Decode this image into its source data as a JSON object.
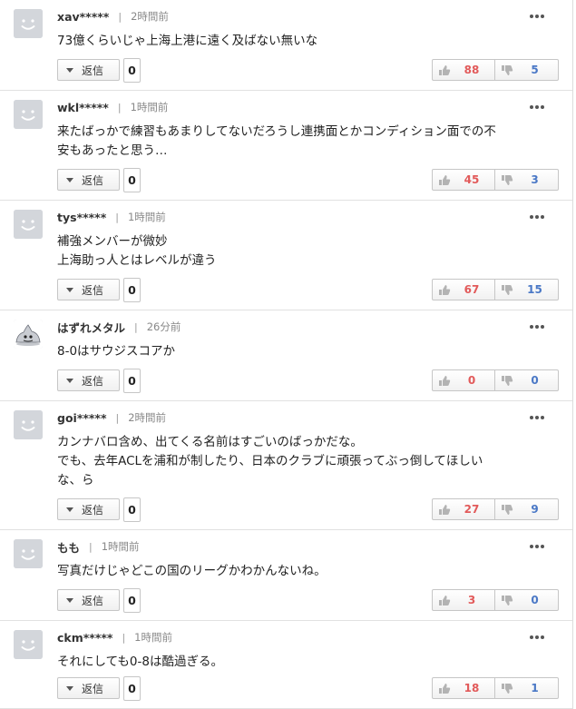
{
  "labels": {
    "reply": "返信"
  },
  "comments": [
    {
      "username": "xav*****",
      "time": "2時間前",
      "avatar": "default-face",
      "lines": [
        "73億くらいじゃ上海上港に遠く及ばない無いな"
      ],
      "reply_count": "0",
      "good": "88",
      "bad": "5"
    },
    {
      "username": "wkl*****",
      "time": "1時間前",
      "avatar": "default-face",
      "lines": [
        "来たばっかで練習もあまりしてないだろうし連携面とかコンディション面での不",
        "安もあったと思う…"
      ],
      "reply_count": "0",
      "good": "45",
      "bad": "3"
    },
    {
      "username": "tys*****",
      "time": "1時間前",
      "avatar": "default-face",
      "lines": [
        "補強メンバーが微妙",
        "上海助っ人とはレベルが違う"
      ],
      "reply_count": "0",
      "good": "67",
      "bad": "15"
    },
    {
      "username": "はずれメタル",
      "time": "26分前",
      "avatar": "metal-slime",
      "lines": [
        "8-0はサウジスコアか"
      ],
      "reply_count": "0",
      "good": "0",
      "bad": "0"
    },
    {
      "username": "goi*****",
      "time": "2時間前",
      "avatar": "default-face",
      "lines": [
        "カンナバロ含め、出てくる名前はすごいのばっかだな。",
        "でも、去年ACLを浦和が制したり、日本のクラブに頑張ってぶっ倒してほしい",
        "な、ら"
      ],
      "reply_count": "0",
      "good": "27",
      "bad": "9"
    },
    {
      "username": "もも",
      "time": "1時間前",
      "avatar": "default-face",
      "lines": [
        "写真だけじゃどこの国のリーグかわかんないね。"
      ],
      "reply_count": "0",
      "good": "3",
      "bad": "0"
    },
    {
      "username": "ckm*****",
      "time": "1時間前",
      "avatar": "default-face",
      "lines": [
        "それにしても0-8は酷過ぎる。"
      ],
      "reply_count": "0",
      "good": "18",
      "bad": "1"
    }
  ]
}
